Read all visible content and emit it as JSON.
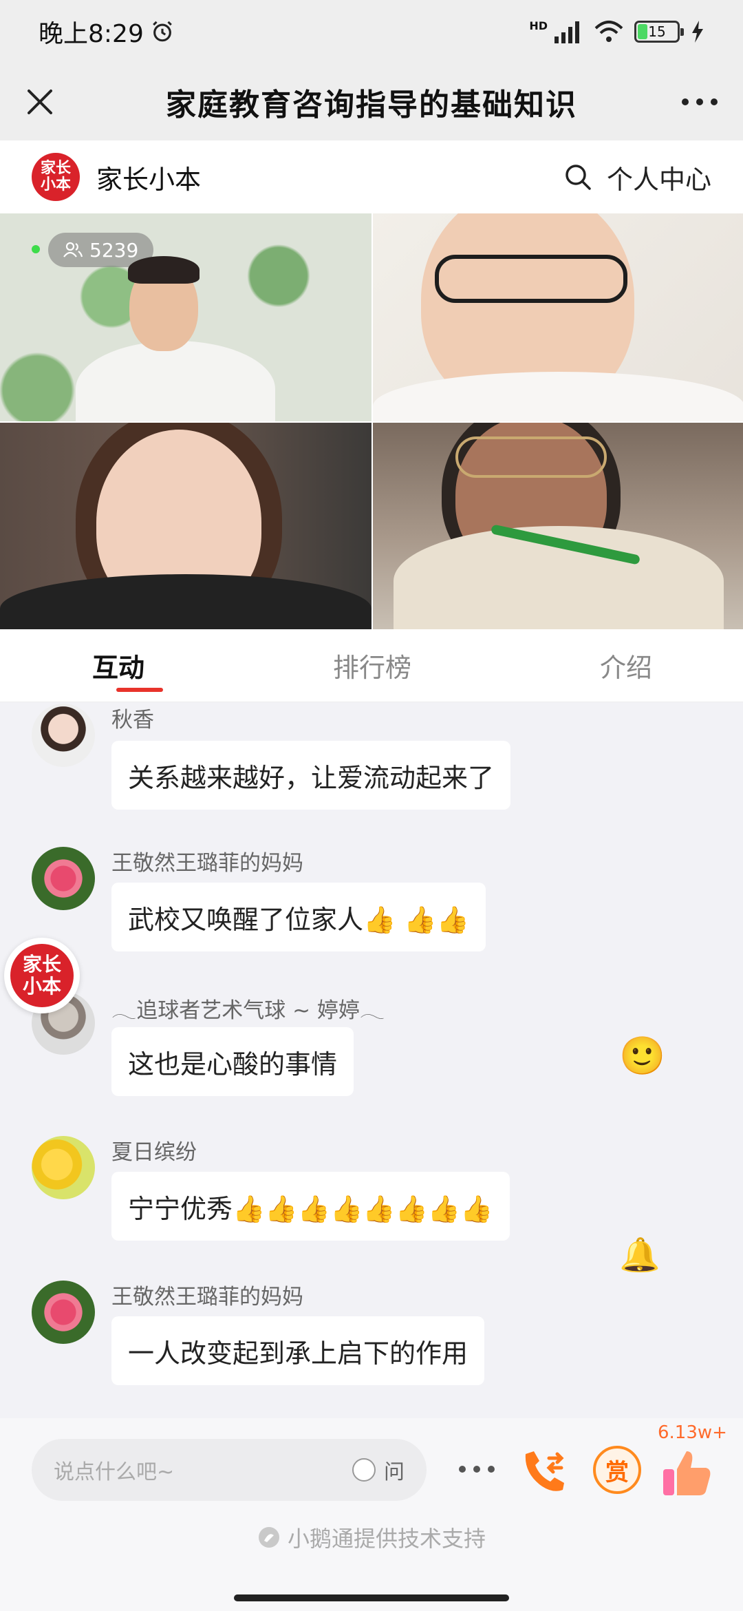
{
  "status_bar": {
    "time": "晚上8:29",
    "network": "HD",
    "battery": "15"
  },
  "header": {
    "title": "家庭教育咨询指导的基础知识"
  },
  "channel": {
    "logo_text_line1": "家长",
    "logo_text_line2": "小本",
    "name": "家长小本",
    "personal_center": "个人中心"
  },
  "video": {
    "viewer_count": "5239"
  },
  "tabs": [
    {
      "label": "互动",
      "active": true
    },
    {
      "label": "排行榜",
      "active": false
    },
    {
      "label": "介绍",
      "active": false
    }
  ],
  "messages": [
    {
      "name": "秋香",
      "text": "关系越来越好，让爱流动起来了",
      "avatar": "woman-avatar"
    },
    {
      "name": "王敬然王璐菲的妈妈",
      "text": "武校又唤醒了位家人👍 👍👍",
      "avatar": "flower-avatar"
    },
    {
      "name": "𓂃追球者艺术气球 ~ 婷婷𓂃",
      "text": "这也是心酸的事情",
      "avatar": "balloon-avatar"
    },
    {
      "name": "夏日缤纷",
      "text": "宁宁优秀👍👍👍👍👍👍👍👍",
      "avatar": "sun-avatar"
    },
    {
      "name": "王敬然王璐菲的妈妈",
      "text": "一人改变起到承上启下的作用",
      "avatar": "flower-avatar"
    }
  ],
  "floating": {
    "logo_line1": "家长",
    "logo_line2": "小本",
    "smile_emoji": "🙂",
    "bell_emoji": "🔔"
  },
  "input_bar": {
    "placeholder": "说点什么吧~",
    "ask_label": "问",
    "reward_label": "赏",
    "like_count": "6.13w+",
    "support_text": "小鹅通提供技术支持"
  },
  "colors": {
    "accent": "#e8332b",
    "logo_red": "#d9222a",
    "reward_orange": "#ff8a1e"
  }
}
